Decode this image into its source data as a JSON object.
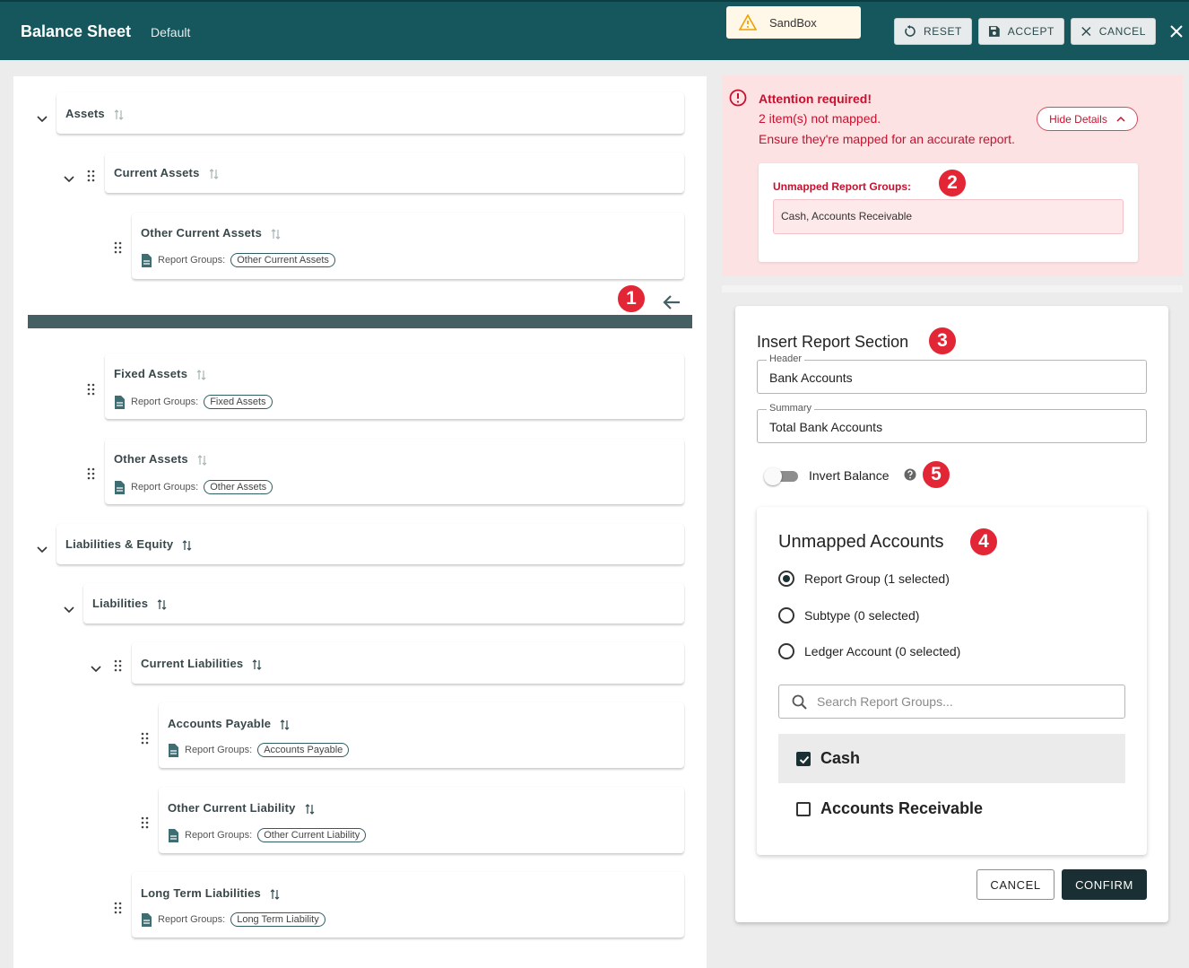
{
  "header": {
    "title": "Balance Sheet",
    "subtitle": "Default",
    "sandbox_label": "SandBox",
    "reset_label": "RESET",
    "accept_label": "ACCEPT",
    "cancel_label": "CANCEL"
  },
  "tree": {
    "assets": "Assets",
    "current_assets": "Current Assets",
    "other_current_assets": "Other Current Assets",
    "fixed_assets": "Fixed Assets",
    "other_assets": "Other Assets",
    "liabilities_equity": "Liabilities & Equity",
    "liabilities": "Liabilities",
    "current_liabilities": "Current Liabilities",
    "accounts_payable": "Accounts Payable",
    "other_current_liability": "Other Current Liability",
    "long_term_liabilities": "Long Term Liabilities",
    "report_groups_label": "Report Groups:",
    "chips": {
      "other_current_assets": "Other Current Assets",
      "fixed_assets": "Fixed Assets",
      "other_assets": "Other Assets",
      "accounts_payable": "Accounts Payable",
      "other_current_liability": "Other Current Liability",
      "long_term_liability": "Long Term Liability"
    }
  },
  "badges": [
    "1",
    "2",
    "3",
    "4",
    "5"
  ],
  "alert": {
    "title": "Attention required!",
    "line1": "2 item(s) not mapped.",
    "line2": "Ensure they're mapped for an accurate report.",
    "hide_details": "Hide Details",
    "unmapped_label": "Unmapped Report Groups:",
    "unmapped_value": "Cash, Accounts Receivable"
  },
  "insert": {
    "title": "Insert Report Section",
    "header_label": "Header",
    "header_value": "Bank Accounts",
    "summary_label": "Summary",
    "summary_value": "Total Bank Accounts",
    "invert_label": "Invert Balance",
    "unmapped_title": "Unmapped Accounts",
    "radios": [
      "Report Group (1 selected)",
      "Subtype (0 selected)",
      "Ledger Account (0 selected)"
    ],
    "search_placeholder": "Search Report Groups...",
    "options": [
      "Cash",
      "Accounts Receivable"
    ],
    "cancel": "CANCEL",
    "confirm": "CONFIRM"
  },
  "colors": {
    "header_bg": "#15575d",
    "alert_text": "#c8102e",
    "badge": "#e32636",
    "confirm_bg": "#1a2f33"
  }
}
